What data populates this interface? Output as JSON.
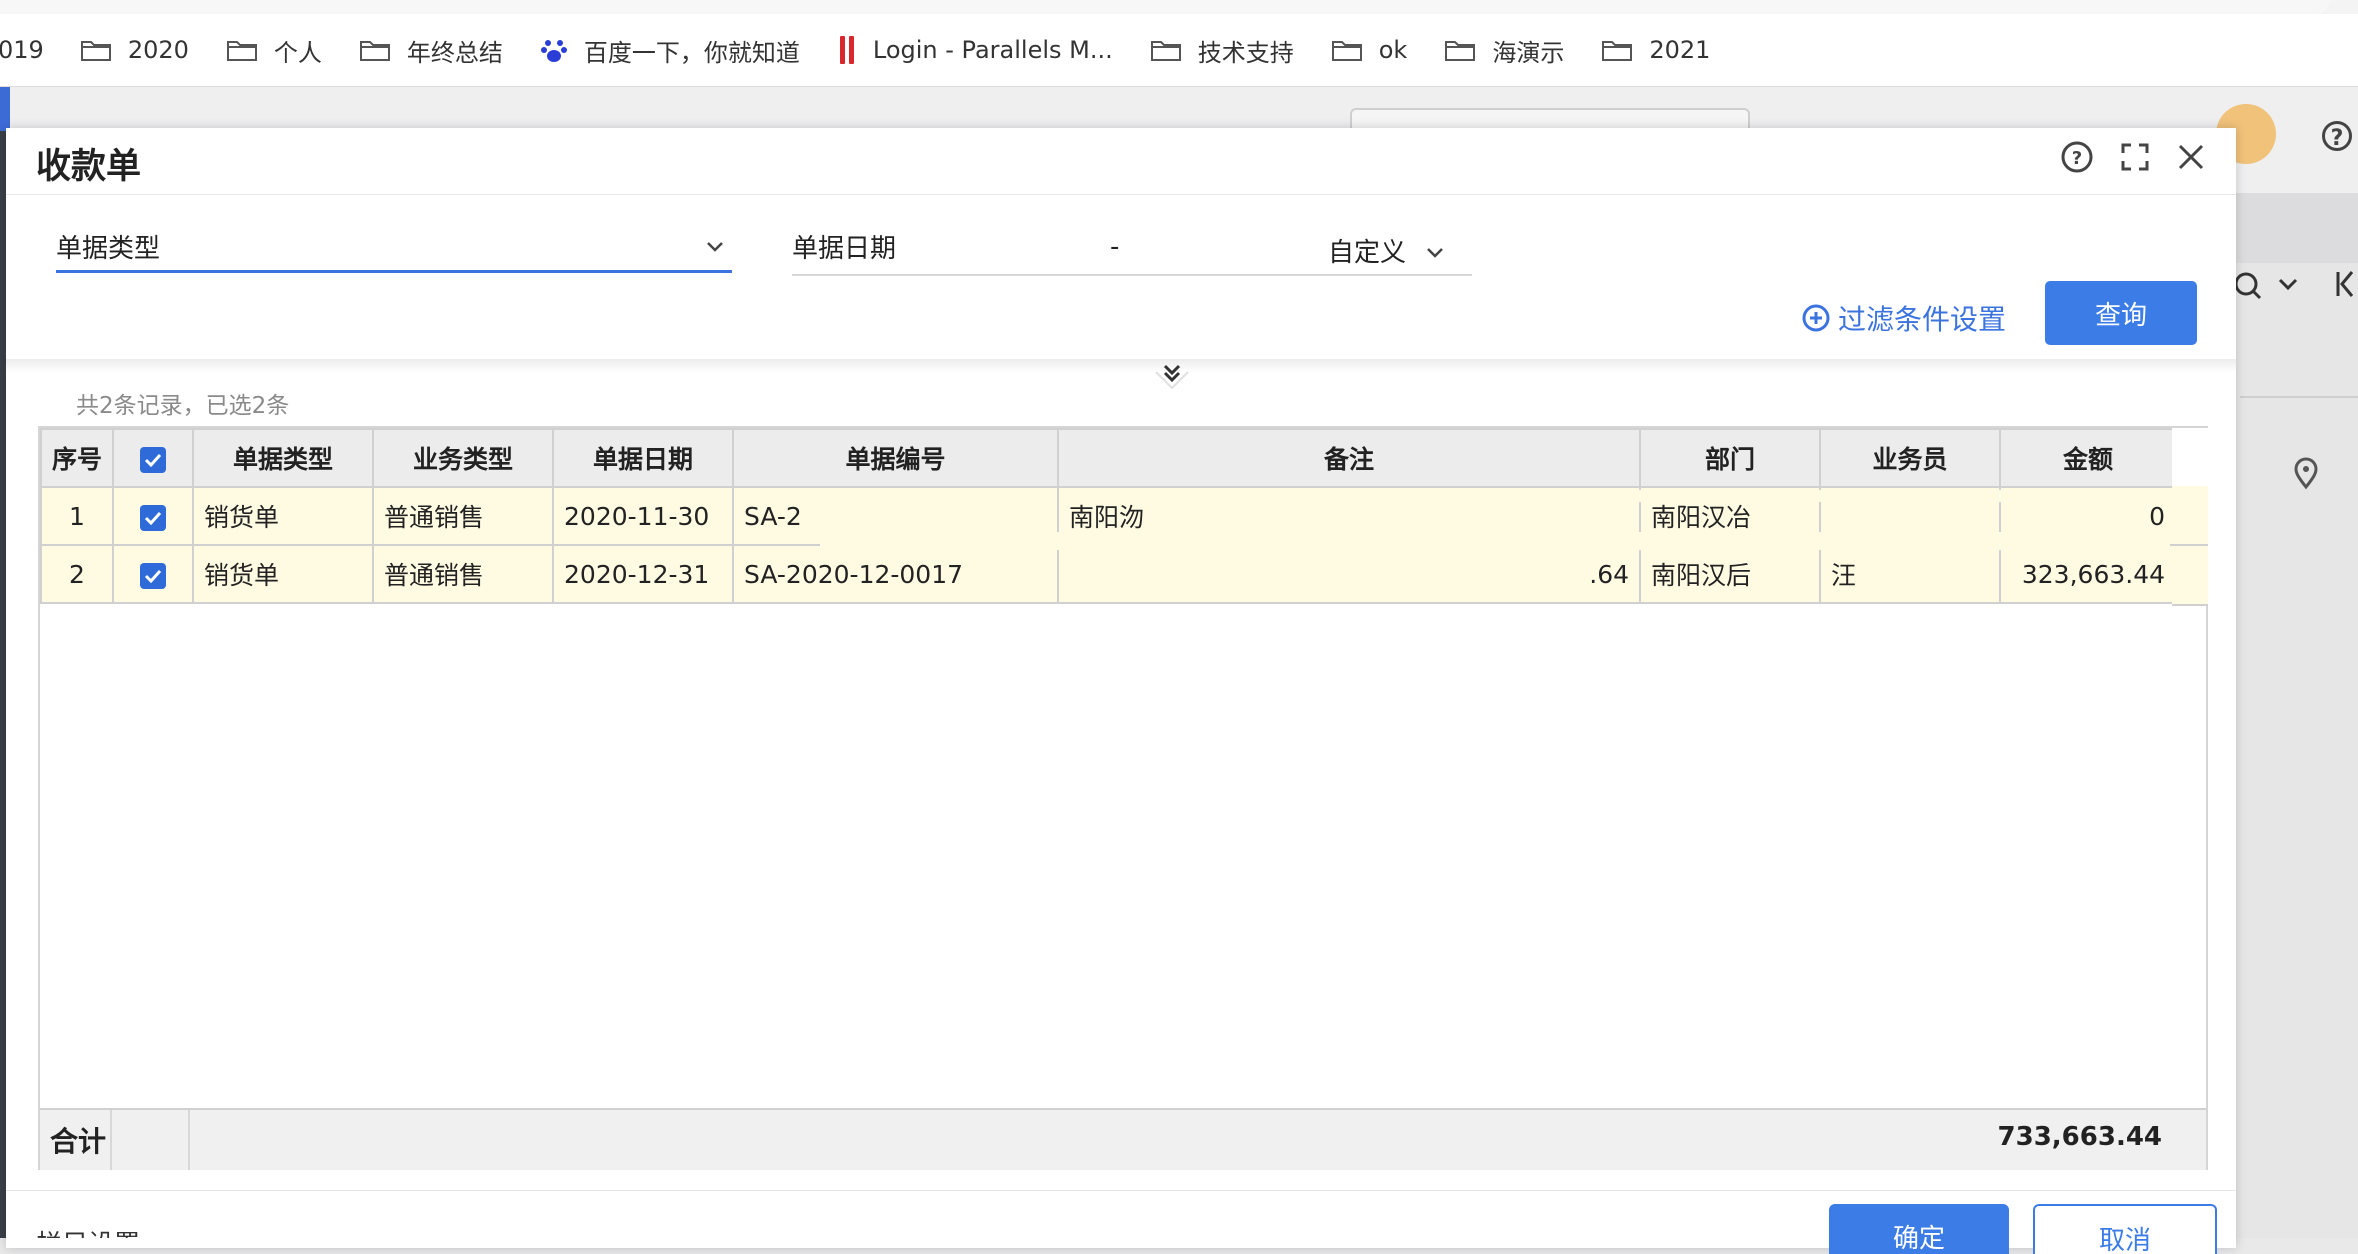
{
  "bookmarks": [
    {
      "label": "019",
      "icon": "none"
    },
    {
      "label": "2020",
      "icon": "folder-icon"
    },
    {
      "label": "个人",
      "icon": "folder-icon"
    },
    {
      "label": "年终总结",
      "icon": "folder-icon"
    },
    {
      "label": "百度一下，你就知道",
      "icon": "baidu-paw-icon"
    },
    {
      "label": "Login - Parallels M...",
      "icon": "parallels-icon"
    },
    {
      "label": "技术支持",
      "icon": "folder-icon"
    },
    {
      "label": "ok",
      "icon": "folder-icon"
    },
    {
      "label": "海演示",
      "icon": "folder-icon"
    },
    {
      "label": "2021",
      "icon": "folder-icon"
    }
  ],
  "dialog": {
    "title": "收款单",
    "filters": {
      "doc_type_label": "单据类型",
      "doc_date_label": "单据日期",
      "date_separator": "-",
      "date_range_value": "自定义",
      "filter_settings_label": "过滤条件设置",
      "query_button": "查询"
    },
    "summary": "共2条记录，已选2条",
    "table": {
      "columns": [
        "序号",
        "",
        "单据类型",
        "业务类型",
        "单据日期",
        "单据编号",
        "备注",
        "部门",
        "业务员",
        "金额"
      ],
      "rows": [
        {
          "seq": "1",
          "checked": true,
          "doc_type": "销货单",
          "biz_type": "普通销售",
          "date": "2020-11-30",
          "doc_no": "SA-2",
          "remark": "南阳沕",
          "remark_right": "",
          "dept": "南阳汉冶",
          "staff": "",
          "amount": "0"
        },
        {
          "seq": "2",
          "checked": true,
          "doc_type": "销货单",
          "biz_type": "普通销售",
          "date": "2020-12-31",
          "doc_no": "SA-2020-12-0017",
          "remark": "",
          "remark_right": ".64",
          "dept": "南阳汉后",
          "staff": "汪",
          "amount": "323,663.44"
        }
      ],
      "total_label": "合计",
      "total_amount": "733,663.44"
    },
    "footer": {
      "left_label": "栏目设置",
      "ok_button": "确定",
      "cancel_button": "取消"
    }
  },
  "colors": {
    "accent": "#3b7ce6",
    "row_highlight": "#fffbe3"
  }
}
